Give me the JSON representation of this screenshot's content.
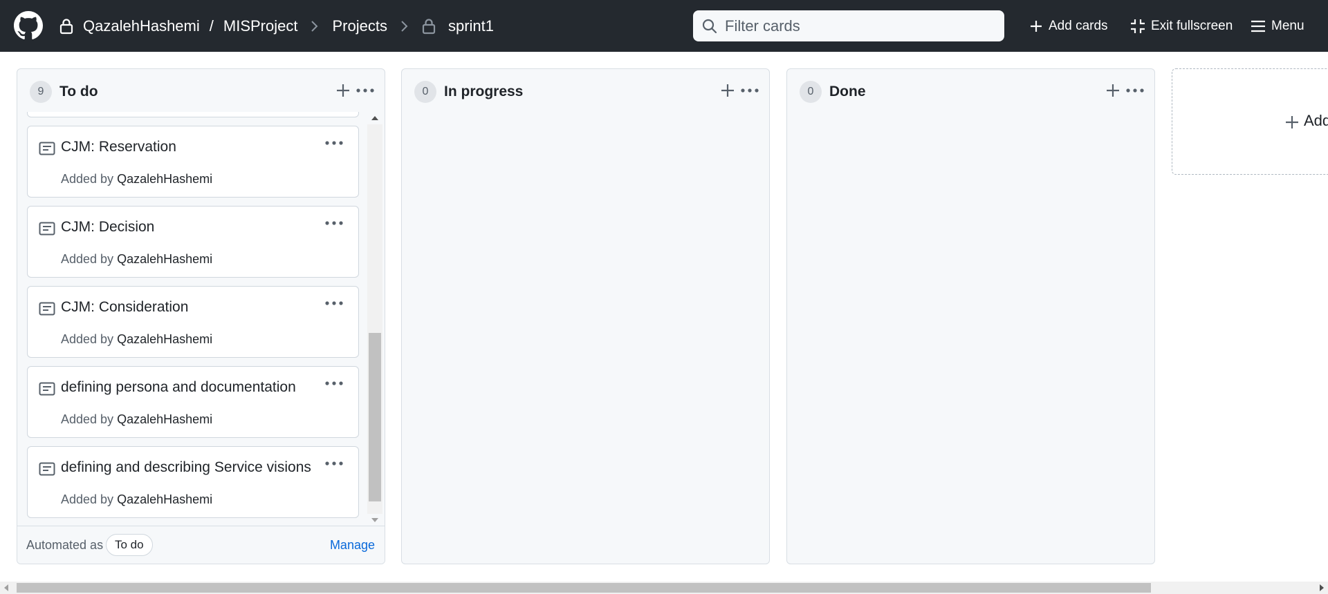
{
  "header": {
    "breadcrumb": {
      "owner": "QazalehHashemi",
      "separator": "/",
      "repo": "MISProject",
      "projects": "Projects",
      "project_name": "sprint1"
    },
    "filter_placeholder": "Filter cards",
    "add_cards_label": "Add cards",
    "exit_fullscreen_label": "Exit fullscreen",
    "menu_label": "Menu"
  },
  "columns": [
    {
      "count": "9",
      "title": "To do",
      "cards": [
        {
          "title": "CJM: Reservation",
          "added_by_label": "Added by",
          "author": "QazalehHashemi"
        },
        {
          "title": "CJM: Decision",
          "added_by_label": "Added by",
          "author": "QazalehHashemi"
        },
        {
          "title": "CJM: Consideration",
          "added_by_label": "Added by",
          "author": "QazalehHashemi"
        },
        {
          "title": "defining persona and documentation",
          "added_by_label": "Added by",
          "author": "QazalehHashemi"
        },
        {
          "title": "defining and describing Service visions",
          "added_by_label": "Added by",
          "author": "QazalehHashemi"
        }
      ],
      "footer": {
        "automated_as": "Automated as",
        "automation": "To do",
        "manage": "Manage"
      }
    },
    {
      "count": "0",
      "title": "In progress"
    },
    {
      "count": "0",
      "title": "Done"
    }
  ],
  "add_column_label": "Add",
  "colors": {
    "header_bg": "#24292f",
    "column_bg": "#f6f8fa",
    "link": "#0969da"
  }
}
